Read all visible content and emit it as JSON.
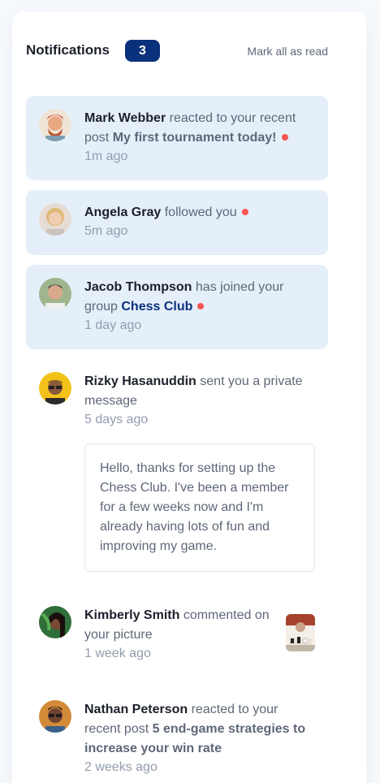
{
  "header": {
    "title": "Notifications",
    "unread_count": "3",
    "mark_all": "Mark all as read"
  },
  "notifications": [
    {
      "name": "Mark Webber",
      "action": "reacted to your recent post",
      "target": "My first tournament today!",
      "time": "1m ago",
      "avatar": "avatar-mark-webber"
    },
    {
      "name": "Angela Gray",
      "action": "followed you",
      "time": "5m ago",
      "avatar": "avatar-angela-gray"
    },
    {
      "name": "Jacob Thompson",
      "action": "has joined your group",
      "target": "Chess Club",
      "time": "1 day ago",
      "avatar": "avatar-jacob-thompson"
    },
    {
      "name": "Rizky Hasanuddin",
      "action": "sent you a private message",
      "time": "5 days ago",
      "message": "Hello, thanks for setting up the Chess Club. I've been a member for a few weeks now and I'm already having lots of fun and improving my game.",
      "avatar": "avatar-rizky-hasanuddin"
    },
    {
      "name": "Kimberly Smith",
      "action": "commented on your picture",
      "time": "1 week ago",
      "avatar": "avatar-kimberly-smith",
      "thumbnail": "chess-picture-thumbnail"
    },
    {
      "name": "Nathan Peterson",
      "action": "reacted to your recent post",
      "target": "5 end-game strategies to increase your win rate",
      "time": "2 weeks ago",
      "avatar": "avatar-nathan-peterson"
    }
  ],
  "colors": {
    "unread_bg": "#e5effa",
    "badge": "#0a317b",
    "dot": "#f65552",
    "name": "#1c202b",
    "text": "#5e6778",
    "time": "#939cad"
  }
}
